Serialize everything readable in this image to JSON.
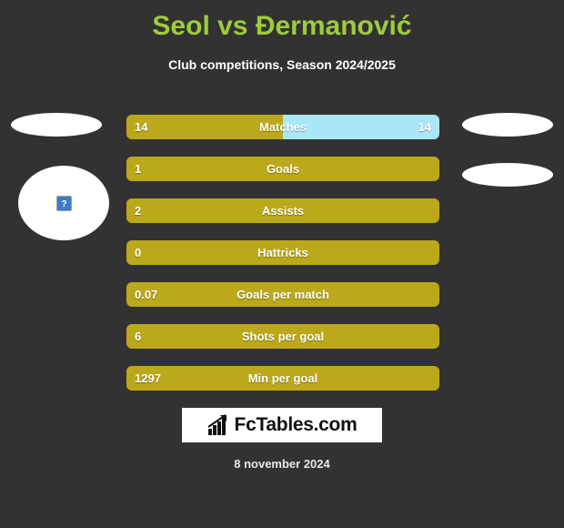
{
  "header": {
    "title": "Seol vs Đermanović",
    "subtitle": "Club competitions, Season 2024/2025",
    "title_color": "#9ECC3B"
  },
  "colors": {
    "background": "#323232",
    "bar_left": "#BCA81B",
    "bar_right": "#A9E7F8",
    "text": "#FFFFFF"
  },
  "players": {
    "left": {
      "flag_alt": "flag-placeholder",
      "photo_alt": "broken-image-placeholder"
    },
    "right": {
      "flag_alt": "flag-placeholder",
      "photo_alt": "photo-placeholder"
    }
  },
  "chart_data": {
    "type": "bar",
    "title": "Seol vs Đermanović",
    "subtitle": "Club competitions, Season 2024/2025",
    "orientation": "horizontal-split",
    "categories": [
      "Matches",
      "Goals",
      "Assists",
      "Hattricks",
      "Goals per match",
      "Shots per goal",
      "Min per goal"
    ],
    "series": [
      {
        "name": "Seol",
        "values": [
          "14",
          "1",
          "2",
          "0",
          "0.07",
          "6",
          "1297"
        ]
      },
      {
        "name": "Đermanović",
        "values": [
          "14",
          "",
          "",
          "",
          "",
          "",
          ""
        ]
      }
    ],
    "left_fill_pct": [
      50,
      100,
      100,
      100,
      100,
      100,
      100
    ],
    "right_fill_pct": [
      50,
      0,
      0,
      0,
      0,
      0,
      0
    ],
    "legend": [],
    "grid": false
  },
  "rows": [
    {
      "label": "Matches",
      "left_value": "14",
      "right_value": "14",
      "left_pct": 50,
      "right_pct": 50
    },
    {
      "label": "Goals",
      "left_value": "1",
      "right_value": "",
      "left_pct": 100,
      "right_pct": 0
    },
    {
      "label": "Assists",
      "left_value": "2",
      "right_value": "",
      "left_pct": 100,
      "right_pct": 0
    },
    {
      "label": "Hattricks",
      "left_value": "0",
      "right_value": "",
      "left_pct": 100,
      "right_pct": 0
    },
    {
      "label": "Goals per match",
      "left_value": "0.07",
      "right_value": "",
      "left_pct": 100,
      "right_pct": 0
    },
    {
      "label": "Shots per goal",
      "left_value": "6",
      "right_value": "",
      "left_pct": 100,
      "right_pct": 0
    },
    {
      "label": "Min per goal",
      "left_value": "1297",
      "right_value": "",
      "left_pct": 100,
      "right_pct": 0
    }
  ],
  "logo": {
    "text": "FcTables.com",
    "icon": "bar-chart-trend-icon"
  },
  "footer": {
    "date": "8 november 2024"
  }
}
